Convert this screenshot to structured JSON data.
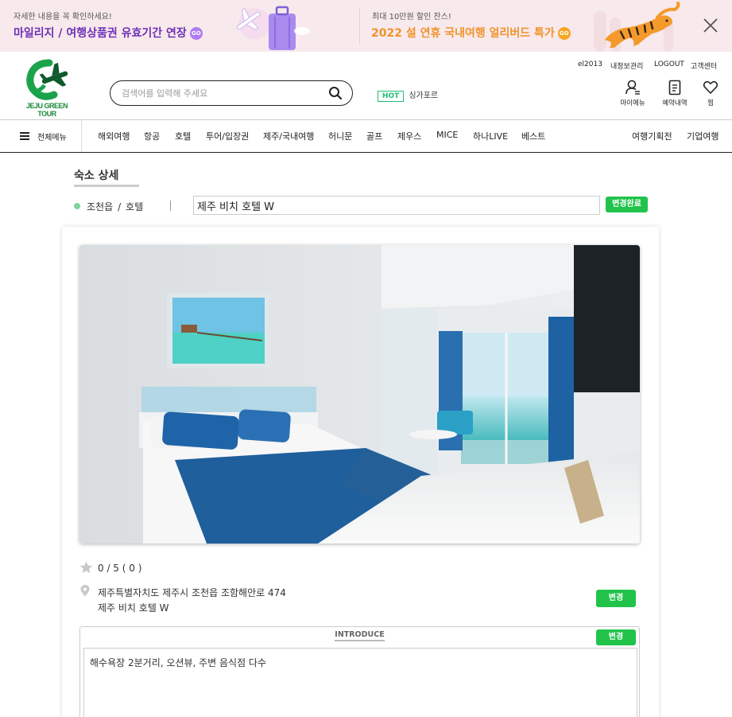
{
  "banner": {
    "left": {
      "small": "자세한 내용을 꼭 확인하세요!",
      "big": "마일리지 / 여행상품권 유효기간 연장",
      "go": "GO"
    },
    "right": {
      "small": "최대 10만원 할인 찬스!",
      "big": "2022 설 연휴 국내여행 얼리버드 특가",
      "go": "GO"
    },
    "colors": {
      "left_text": "#6d2fb8",
      "right_text": "#f0932b",
      "left_go": "#b07cf0",
      "right_go": "#f5a623"
    }
  },
  "header": {
    "logo_text": "JEJU GREEN TOUR",
    "search_placeholder": "검색어를 입력해 주세요",
    "hot_tag": "HOT",
    "hot_keyword": "싱가포르",
    "util_links": [
      "el2013",
      "내정보관리",
      "LOGOUT",
      "고객센터"
    ],
    "quick_links": [
      "마이메뉴",
      "예약내역",
      "찜"
    ]
  },
  "nav": {
    "all_menu": "전체메뉴",
    "items": [
      "해외여행",
      "항공",
      "호텔",
      "투어/입장권",
      "제주/국내여행",
      "허니문",
      "골프",
      "제우스",
      "MICE",
      "하나LIVE",
      "베스트"
    ],
    "right_items": [
      "여행기획전",
      "기업여행"
    ]
  },
  "page": {
    "title": "숙소 상세",
    "region": "조천읍",
    "category": "호텔",
    "hotel_name": "제주 비치 호텔 W",
    "name_done_button": "변경완료",
    "rating": "0 / 5 ( 0 )",
    "address_line1": "제주특별자치도 제주시 조천읍 조함해안로 474",
    "address_line2": "제주 비치 호텔 W",
    "address_change_button": "변경",
    "intro_label": "INTRODUCE",
    "intro_change_button": "변경",
    "intro_text": "해수욕장 2분거리, 오션뷰, 주변 음식점 다수"
  },
  "colors": {
    "accent_green": "#21c34a",
    "brand_green": "#1a8a3a"
  }
}
